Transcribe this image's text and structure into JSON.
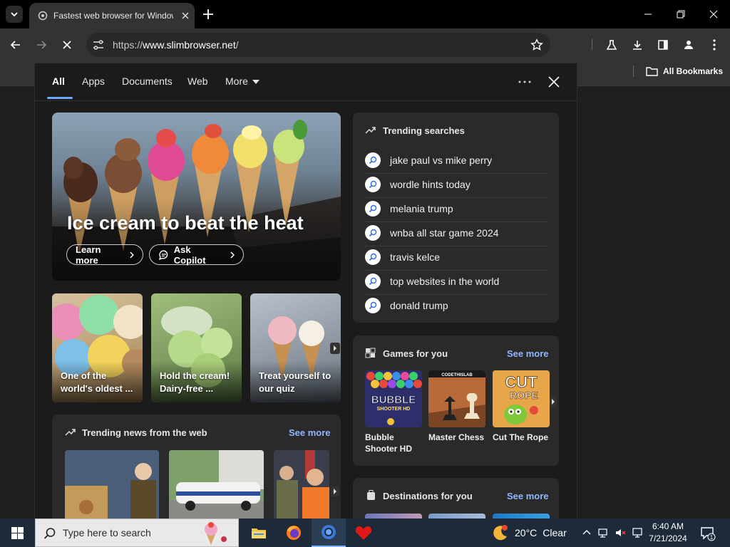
{
  "tab": {
    "title": "Fastest web browser for Windows"
  },
  "omnibox": {
    "url_prefix": "https://",
    "url_domain": "www.slimbrowser.net",
    "url_path": "/"
  },
  "bookmarks": {
    "all_label": "All Bookmarks"
  },
  "panel": {
    "tabs": [
      {
        "label": "All"
      },
      {
        "label": "Apps"
      },
      {
        "label": "Documents"
      },
      {
        "label": "Web"
      },
      {
        "label": "More"
      }
    ]
  },
  "hero": {
    "title": "Ice cream to beat the heat",
    "learn_more": "Learn more",
    "ask_copilot": "Ask Copilot"
  },
  "cards": [
    {
      "line1": "One of the",
      "line2": "world's oldest ..."
    },
    {
      "line1": "Hold the cream!",
      "line2": "Dairy-free ..."
    },
    {
      "line1": "Treat yourself to",
      "line2": "our quiz"
    }
  ],
  "news": {
    "title": "Trending news from the web",
    "see_more": "See more"
  },
  "trending": {
    "title": "Trending searches",
    "items": [
      "jake paul vs mike perry",
      "wordle hints today",
      "melania trump",
      "wnba all star game 2024",
      "travis kelce",
      "top websites in the world",
      "donald trump"
    ]
  },
  "games": {
    "title": "Games for you",
    "see_more": "See more",
    "items": [
      {
        "line1": "Bubble",
        "line2": "Shooter HD",
        "thumb_text": "BUBBLE",
        "thumb_sub": "SHOOTER HD"
      },
      {
        "line1": "Master Chess",
        "line2": "",
        "thumb_text": "CODETHISLAB"
      },
      {
        "line1": "Cut The Rope",
        "line2": "",
        "thumb_text": "CUT",
        "thumb_sub": "ROPE"
      }
    ]
  },
  "destinations": {
    "title": "Destinations for you",
    "see_more": "See more"
  },
  "taskbar": {
    "search_placeholder": "Type here to search",
    "weather_temp": "20°C",
    "weather_text": "Clear",
    "time": "6:40 AM",
    "date": "7/21/2024",
    "notification_count": "1"
  },
  "colors": {
    "accent": "#6aa7ff",
    "link": "#8fb6ff",
    "panel_bg": "#1b1b1b",
    "block_bg": "#2a2a2a"
  }
}
